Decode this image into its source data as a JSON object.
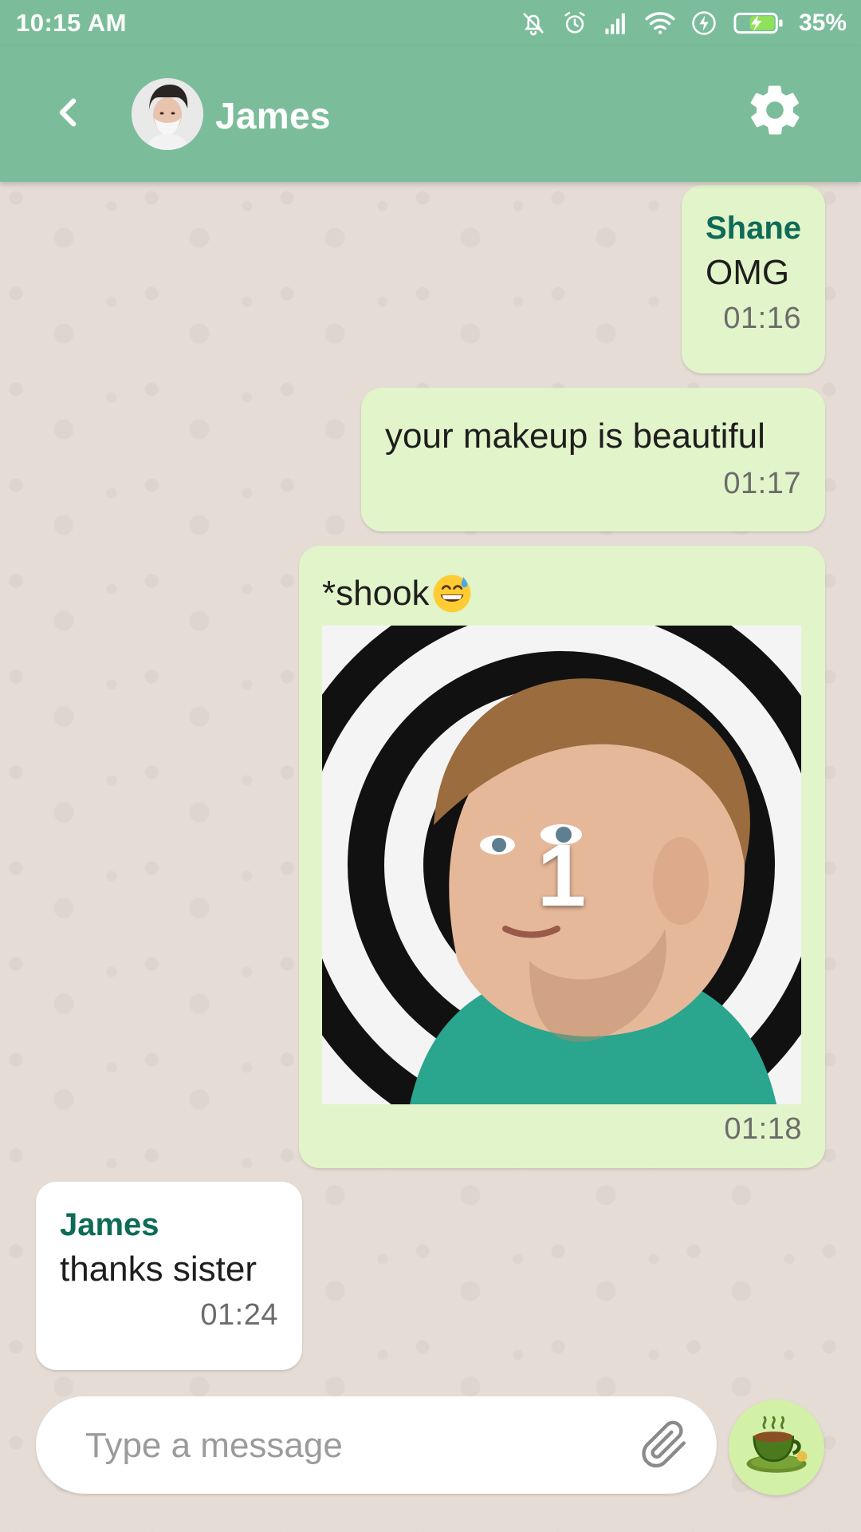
{
  "status_bar": {
    "time": "10:15 AM",
    "battery_percent": "35%",
    "icons": [
      "mute-icon",
      "alarm-icon",
      "signal-icon",
      "wifi-icon",
      "charging-icon",
      "battery-icon"
    ]
  },
  "header": {
    "back_icon": "back-arrow-icon",
    "contact_name": "James",
    "avatar": "contact-avatar",
    "settings_icon": "gear-icon"
  },
  "messages": [
    {
      "direction": "outgoing",
      "sender": "Shane",
      "text": "OMG",
      "time": "01:16"
    },
    {
      "direction": "outgoing",
      "text": "your makeup is beautiful",
      "time": "01:17"
    },
    {
      "direction": "outgoing",
      "text": "*shook",
      "emoji": "grinning-sweat-emoji",
      "image_overlay": "1",
      "time": "01:18"
    },
    {
      "direction": "incoming",
      "sender": "James",
      "text": "thanks sister",
      "time": "01:24"
    }
  ],
  "composer": {
    "placeholder": "Type a message",
    "value": "",
    "attach_icon": "paperclip-icon",
    "send_icon": "coffee-cup-icon"
  },
  "colors": {
    "primary": "#7bbd9a",
    "outgoing_bubble": "#e2f4c9",
    "incoming_bubble": "#ffffff",
    "sender_name": "#0e6b57",
    "chat_background": "#e5ddd5",
    "send_button": "#d3f0a7"
  }
}
